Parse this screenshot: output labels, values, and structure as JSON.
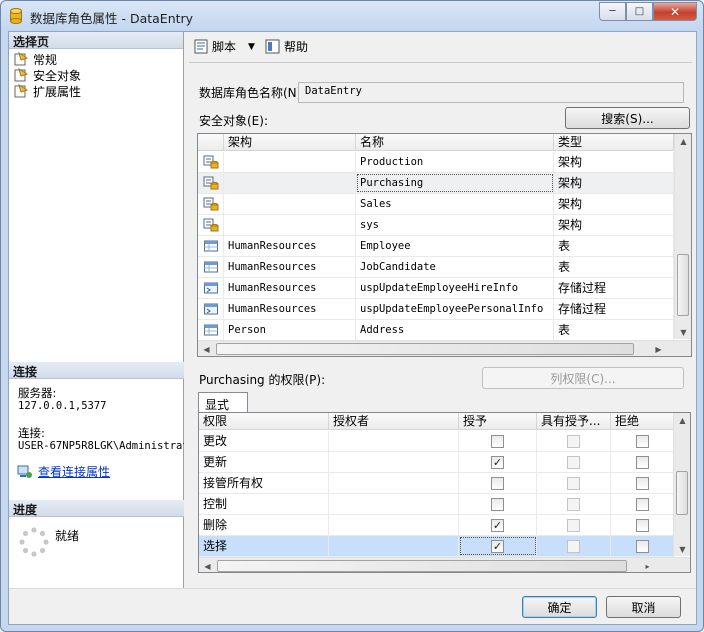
{
  "window": {
    "title": "数据库角色属性 - DataEntry",
    "controls": {
      "minimize": "─",
      "maximize": "□",
      "close": "✕"
    }
  },
  "left_panel": {
    "header": "选择页",
    "pages": [
      {
        "label": "常规",
        "icon": "page-icon"
      },
      {
        "label": "安全对象",
        "icon": "page-icon"
      },
      {
        "label": "扩展属性",
        "icon": "page-icon"
      }
    ],
    "connection": {
      "header": "连接",
      "server_label": "服务器:",
      "server_value": "127.0.0.1,5377",
      "conn_label": "连接:",
      "conn_value": "USER-67NP5R8LGK\\Administrat",
      "view_link": "查看连接属性"
    },
    "progress": {
      "header": "进度",
      "status": "就绪"
    }
  },
  "toolbar": {
    "script_label": "脚本",
    "help_label": "帮助"
  },
  "role_name_label": "数据库角色名称(N):",
  "role_name_value": "DataEntry",
  "securables_label": "安全对象(E):",
  "search_button": "搜索(S)...",
  "securables": {
    "columns": [
      "架构",
      "名称",
      "类型"
    ],
    "rows": [
      {
        "schema": "",
        "name": "Production",
        "type": "架构",
        "icon": "schema-icon"
      },
      {
        "schema": "",
        "name": "Purchasing",
        "type": "架构",
        "icon": "schema-icon"
      },
      {
        "schema": "",
        "name": "Sales",
        "type": "架构",
        "icon": "schema-icon"
      },
      {
        "schema": "",
        "name": "sys",
        "type": "架构",
        "icon": "schema-icon"
      },
      {
        "schema": "HumanResources",
        "name": "Employee",
        "type": "表",
        "icon": "table-icon"
      },
      {
        "schema": "HumanResources",
        "name": "JobCandidate",
        "type": "表",
        "icon": "table-icon"
      },
      {
        "schema": "HumanResources",
        "name": "uspUpdateEmployeeHireInfo",
        "type": "存储过程",
        "icon": "proc-icon"
      },
      {
        "schema": "HumanResources",
        "name": "uspUpdateEmployeePersonalInfo",
        "type": "存储过程",
        "icon": "proc-icon"
      },
      {
        "schema": "Person",
        "name": "Address",
        "type": "表",
        "icon": "table-icon"
      }
    ]
  },
  "permissions_label": "Purchasing 的权限(P):",
  "column_perms_button": "列权限(C)...",
  "tab_label": "显式",
  "permissions": {
    "columns": [
      "权限",
      "授权者",
      "授予",
      "具有授予...",
      "拒绝"
    ],
    "scroll_arrow_h": "▸",
    "rows": [
      {
        "perm": "更改",
        "grantor": "",
        "grant": false,
        "with_grant": false,
        "deny": false
      },
      {
        "perm": "更新",
        "grantor": "",
        "grant": true,
        "with_grant": false,
        "deny": false
      },
      {
        "perm": "接管所有权",
        "grantor": "",
        "grant": false,
        "with_grant": false,
        "deny": false
      },
      {
        "perm": "控制",
        "grantor": "",
        "grant": false,
        "with_grant": false,
        "deny": false
      },
      {
        "perm": "删除",
        "grantor": "",
        "grant": true,
        "with_grant": false,
        "deny": false
      },
      {
        "perm": "选择",
        "grantor": "",
        "grant": true,
        "with_grant": false,
        "deny": false
      }
    ]
  },
  "ok_button": "确定",
  "cancel_button": "取消",
  "colors": {
    "selection": "#c7dffa",
    "link": "#0033cc"
  }
}
